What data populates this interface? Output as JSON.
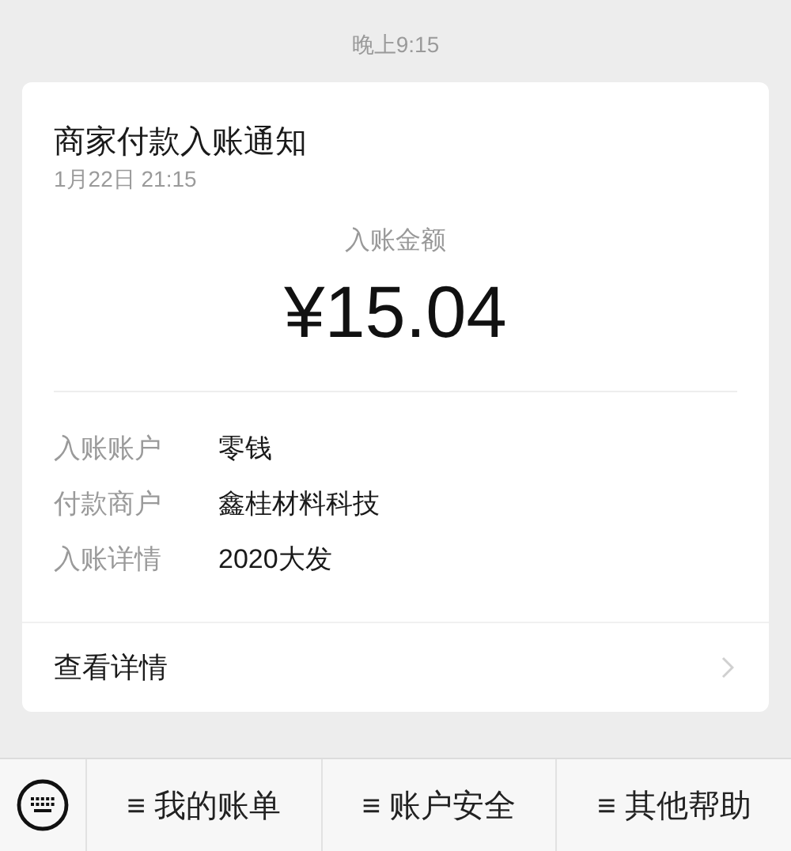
{
  "time_label": "晚上9:15",
  "card": {
    "title": "商家付款入账通知",
    "date": "1月22日  21:15",
    "amount_label": "入账金额",
    "amount": "¥15.04",
    "rows": [
      {
        "label": "入账账户",
        "value": "零钱"
      },
      {
        "label": "付款商户",
        "value": "鑫桂材料科技"
      },
      {
        "label": "入账详情",
        "value": "2020大发"
      }
    ],
    "details_link": "查看详情"
  },
  "menu": [
    "≡ 我的账单",
    "≡ 账户安全",
    "≡ 其他帮助"
  ]
}
